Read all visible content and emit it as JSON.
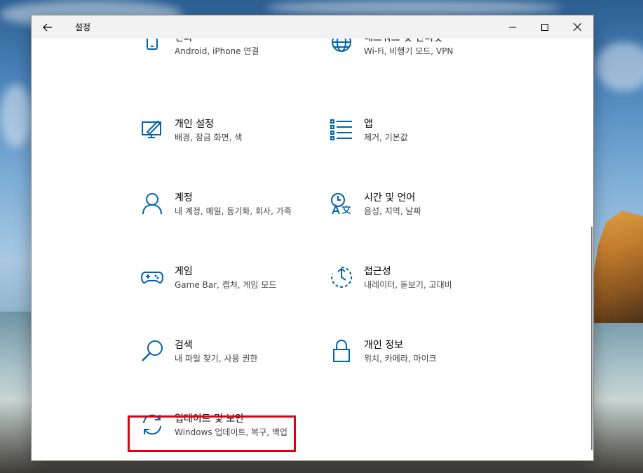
{
  "window": {
    "title": "설정"
  },
  "tiles": [
    {
      "title": "전화",
      "desc": "Android, iPhone 연결",
      "icon": "phone-icon"
    },
    {
      "title": "네트워크 및 인터넷",
      "desc": "Wi-Fi, 비행기 모드, VPN",
      "icon": "globe-icon"
    },
    {
      "title": "개인 설정",
      "desc": "배경, 잠금 화면, 색",
      "icon": "personalization-icon"
    },
    {
      "title": "앱",
      "desc": "제거, 기본값",
      "icon": "apps-list-icon"
    },
    {
      "title": "계정",
      "desc": "내 계정, 메일, 동기화, 회사, 가족",
      "icon": "person-icon"
    },
    {
      "title": "시간 및 언어",
      "desc": "음성, 지역, 날짜",
      "icon": "time-language-icon"
    },
    {
      "title": "게임",
      "desc": "Game Bar, 캡처, 게임 모드",
      "icon": "gamepad-icon"
    },
    {
      "title": "접근성",
      "desc": "내레이터, 돋보기, 고대비",
      "icon": "accessibility-timer-icon"
    },
    {
      "title": "검색",
      "desc": "내 파일 찾기, 사용 권한",
      "icon": "search-icon"
    },
    {
      "title": "개인 정보",
      "desc": "위치, 카메라, 마이크",
      "icon": "lock-icon"
    },
    {
      "title": "업데이트 및 보안",
      "desc": "Windows 업데이트, 복구, 백업",
      "icon": "sync-icon"
    }
  ],
  "colors": {
    "accent": "#0063b1",
    "highlight": "#e00012"
  }
}
